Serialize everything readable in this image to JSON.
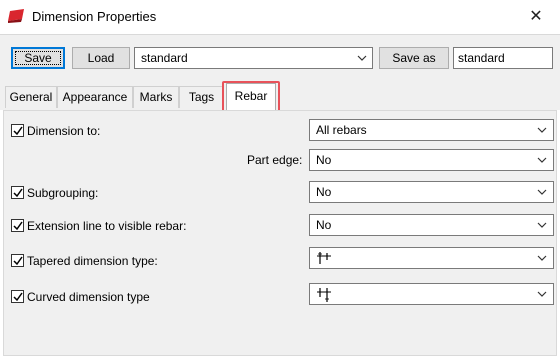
{
  "window": {
    "title": "Dimension Properties",
    "close_glyph": "✕"
  },
  "toolbar": {
    "save_label": "Save",
    "load_label": "Load",
    "preset_value": "standard",
    "save_as_label": "Save as",
    "save_as_value": "standard"
  },
  "tabs": [
    {
      "label": "General",
      "active": false
    },
    {
      "label": "Appearance",
      "active": false
    },
    {
      "label": "Marks",
      "active": false
    },
    {
      "label": "Tags",
      "active": false
    },
    {
      "label": "Rebar",
      "active": true
    }
  ],
  "rebar": {
    "dimension_to": {
      "label": "Dimension to:",
      "checked": true,
      "value": "All rebars"
    },
    "part_edge": {
      "label": "Part edge:",
      "value": "No"
    },
    "subgrouping": {
      "label": "Subgrouping:",
      "checked": true,
      "value": "No"
    },
    "extension_line": {
      "label": "Extension line to visible rebar:",
      "checked": true,
      "value": "No"
    },
    "tapered_type": {
      "label": "Tapered dimension type:",
      "checked": true,
      "value_icon": "tapered-dimension-glyph-icon"
    },
    "curved_type": {
      "label": "Curved dimension type",
      "checked": true,
      "value_icon": "curved-dimension-glyph-icon"
    }
  },
  "colors": {
    "accent": "#0078d7",
    "highlight": "#e8525a",
    "app_icon": "#d9262e"
  }
}
